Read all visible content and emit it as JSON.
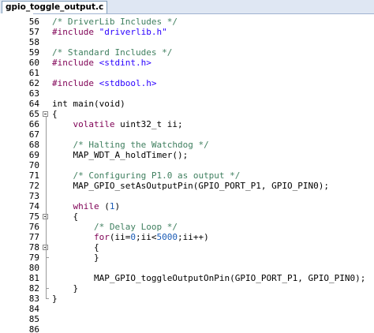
{
  "editor": {
    "tab_title": "gpio_toggle_output.c"
  },
  "lines": [
    {
      "num": "56",
      "tokens": [
        {
          "t": "/* DriverLib Includes */",
          "c": "comment"
        }
      ]
    },
    {
      "num": "57",
      "tokens": [
        {
          "t": "#include ",
          "c": "preproc"
        },
        {
          "t": "\"driverlib.h\"",
          "c": "string"
        }
      ]
    },
    {
      "num": "58",
      "tokens": []
    },
    {
      "num": "59",
      "tokens": [
        {
          "t": "/* Standard Includes */",
          "c": "comment"
        }
      ]
    },
    {
      "num": "60",
      "tokens": [
        {
          "t": "#include ",
          "c": "preproc"
        },
        {
          "t": "<stdint.h>",
          "c": "string"
        }
      ]
    },
    {
      "num": "61",
      "tokens": []
    },
    {
      "num": "62",
      "tokens": [
        {
          "t": "#include ",
          "c": "preproc"
        },
        {
          "t": "<stdbool.h>",
          "c": "string"
        }
      ]
    },
    {
      "num": "63",
      "tokens": []
    },
    {
      "num": "64",
      "tokens": [
        {
          "t": "int main(void)",
          "c": "plain"
        }
      ]
    },
    {
      "num": "65",
      "tokens": [
        {
          "t": "{",
          "c": "plain"
        }
      ],
      "fold": "open"
    },
    {
      "num": "66",
      "tokens": [
        {
          "t": "    ",
          "c": "plain"
        },
        {
          "t": "volatile",
          "c": "keyword"
        },
        {
          "t": " uint32_t ii;",
          "c": "plain"
        }
      ]
    },
    {
      "num": "67",
      "tokens": []
    },
    {
      "num": "68",
      "tokens": [
        {
          "t": "    ",
          "c": "plain"
        },
        {
          "t": "/* Halting the Watchdog */",
          "c": "comment"
        }
      ]
    },
    {
      "num": "69",
      "tokens": [
        {
          "t": "    MAP_WDT_A_holdTimer();",
          "c": "plain"
        }
      ]
    },
    {
      "num": "70",
      "tokens": []
    },
    {
      "num": "71",
      "tokens": [
        {
          "t": "    ",
          "c": "plain"
        },
        {
          "t": "/* Configuring P1.0 as output */",
          "c": "comment"
        }
      ]
    },
    {
      "num": "72",
      "tokens": [
        {
          "t": "    MAP_GPIO_setAsOutputPin(GPIO_PORT_P1, GPIO_PIN0);",
          "c": "plain"
        }
      ]
    },
    {
      "num": "73",
      "tokens": []
    },
    {
      "num": "74",
      "tokens": [
        {
          "t": "    ",
          "c": "plain"
        },
        {
          "t": "while",
          "c": "keyword"
        },
        {
          "t": " (",
          "c": "plain"
        },
        {
          "t": "1",
          "c": "number"
        },
        {
          "t": ")",
          "c": "plain"
        }
      ]
    },
    {
      "num": "75",
      "tokens": [
        {
          "t": "    {",
          "c": "plain"
        }
      ],
      "fold": "open"
    },
    {
      "num": "76",
      "tokens": [
        {
          "t": "        ",
          "c": "plain"
        },
        {
          "t": "/* Delay Loop */",
          "c": "comment"
        }
      ]
    },
    {
      "num": "77",
      "tokens": [
        {
          "t": "        ",
          "c": "plain"
        },
        {
          "t": "for",
          "c": "keyword"
        },
        {
          "t": "(ii=",
          "c": "plain"
        },
        {
          "t": "0",
          "c": "number"
        },
        {
          "t": ";ii<",
          "c": "plain"
        },
        {
          "t": "5000",
          "c": "number"
        },
        {
          "t": ";ii++)",
          "c": "plain"
        }
      ]
    },
    {
      "num": "78",
      "tokens": [
        {
          "t": "        {",
          "c": "plain"
        }
      ],
      "fold": "open"
    },
    {
      "num": "79",
      "tokens": [
        {
          "t": "        }",
          "c": "plain"
        }
      ],
      "fold": "end"
    },
    {
      "num": "80",
      "tokens": []
    },
    {
      "num": "81",
      "tokens": [
        {
          "t": "        MAP_GPIO_toggleOutputOnPin(GPIO_PORT_P1, GPIO_PIN0);",
          "c": "plain"
        }
      ]
    },
    {
      "num": "82",
      "tokens": [
        {
          "t": "    }",
          "c": "plain"
        }
      ],
      "fold": "end"
    },
    {
      "num": "83",
      "tokens": [
        {
          "t": "}",
          "c": "plain"
        }
      ],
      "fold": "end"
    },
    {
      "num": "84",
      "tokens": []
    },
    {
      "num": "85",
      "tokens": []
    },
    {
      "num": "86",
      "tokens": []
    }
  ],
  "colors": {
    "comment": "#3f7f5f",
    "keyword": "#7f0055",
    "preproc": "#7f0055",
    "string": "#2a00ff",
    "number": "#1a5bb5"
  }
}
